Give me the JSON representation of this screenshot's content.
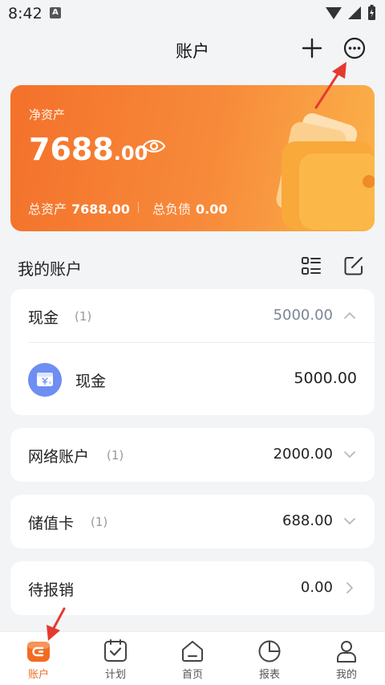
{
  "status_bar": {
    "time": "8:42",
    "notif_badge": "A"
  },
  "header": {
    "title": "账户"
  },
  "summary_card": {
    "label": "净资产",
    "amount_int": "7688",
    "amount_dec": ".00",
    "total_assets_label": "总资产",
    "total_assets": "7688.00",
    "total_debt_label": "总负债",
    "total_debt": "0.00"
  },
  "section": {
    "title": "我的账户"
  },
  "groups": [
    {
      "name": "现金",
      "count": "(1)",
      "amount": "5000.00",
      "state": "expanded"
    },
    {
      "name": "网络账户",
      "count": "(1)",
      "amount": "2000.00",
      "state": "collapsed"
    },
    {
      "name": "储值卡",
      "count": "(1)",
      "amount": "688.00",
      "state": "collapsed"
    },
    {
      "name": "待报销",
      "count": "",
      "amount": "0.00",
      "state": "link"
    }
  ],
  "cash_accounts": [
    {
      "name": "现金",
      "amount": "5000.00",
      "icon": "cash-yen-icon"
    }
  ],
  "tabbar": {
    "tabs": [
      {
        "label": "账户",
        "icon": "account-tab-icon",
        "active": true
      },
      {
        "label": "计划",
        "icon": "plan-tab-icon",
        "active": false
      },
      {
        "label": "首页",
        "icon": "home-tab-icon",
        "active": false
      },
      {
        "label": "报表",
        "icon": "report-tab-icon",
        "active": false
      },
      {
        "label": "我的",
        "icon": "profile-tab-icon",
        "active": false
      }
    ]
  },
  "colors": {
    "accent": "#f26b21",
    "card_start": "#f4712b",
    "card_end": "#fbb24a",
    "annotation_arrow": "#e53a2f"
  }
}
